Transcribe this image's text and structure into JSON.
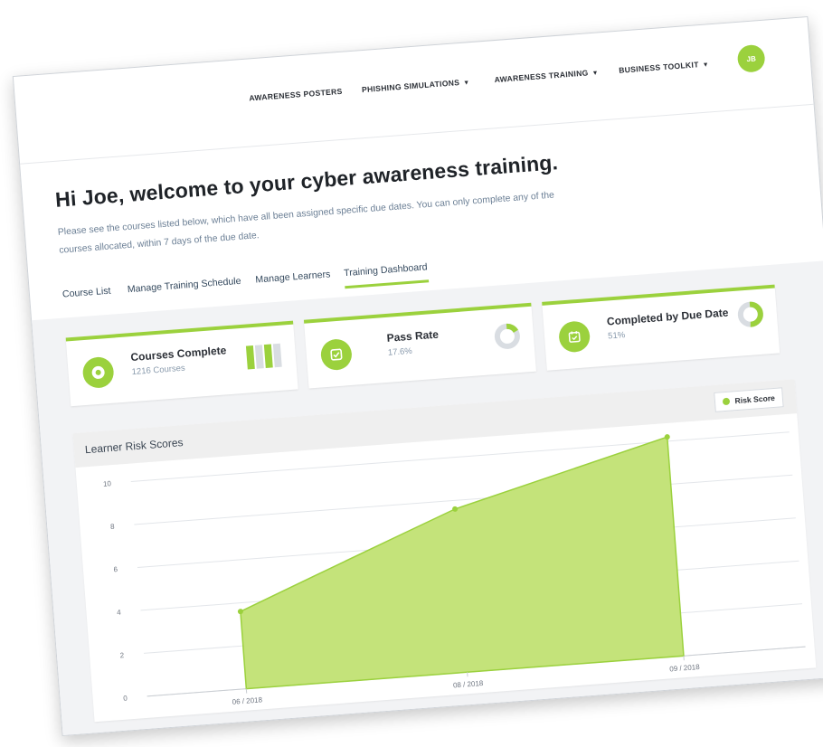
{
  "nav": {
    "items": [
      {
        "label": "AWARENESS POSTERS",
        "dropdown": false
      },
      {
        "label": "PHISHING SIMULATIONS",
        "dropdown": true
      },
      {
        "label": "AWARENESS TRAINING",
        "dropdown": true
      },
      {
        "label": "BUSINESS TOOLKIT",
        "dropdown": true
      }
    ],
    "user_initials": "JB",
    "caret": "▼"
  },
  "welcome": {
    "title": "Hi Joe, welcome to your cyber awareness training.",
    "intro": "Please see the courses listed below, which have all been assigned specific due dates. You can only complete any of the courses allocated, within 7 days of the due date."
  },
  "tabs": [
    {
      "label": "Course List",
      "active": false
    },
    {
      "label": "Manage Training Schedule",
      "active": false
    },
    {
      "label": "Manage Learners",
      "active": false
    },
    {
      "label": "Training Dashboard",
      "active": true
    }
  ],
  "stats": [
    {
      "title": "Courses Complete",
      "subtitle": "1216 Courses",
      "icon": "donut-icon"
    },
    {
      "title": "Pass Rate",
      "subtitle": "17.6%",
      "icon": "checkbox-icon",
      "fraction": 0.176
    },
    {
      "title": "Completed by Due Date",
      "subtitle": "51%",
      "icon": "calendar-check-icon",
      "fraction": 0.51
    }
  ],
  "colors": {
    "accent": "#9bd13d",
    "accent_light": "#c4e37a",
    "muted": "#d9dde2"
  },
  "chart_data": {
    "type": "area",
    "title": "Learner Risk Scores",
    "x": [
      "06 / 2018",
      "08 / 2018",
      "09 / 2018"
    ],
    "series": [
      {
        "name": "Risk Score",
        "values": [
          3.6,
          7.6,
          10.2
        ]
      }
    ],
    "ylim": [
      0,
      10
    ],
    "yticks": [
      0,
      2,
      4,
      6,
      8,
      10
    ],
    "grid": true,
    "legend": "top-right"
  }
}
